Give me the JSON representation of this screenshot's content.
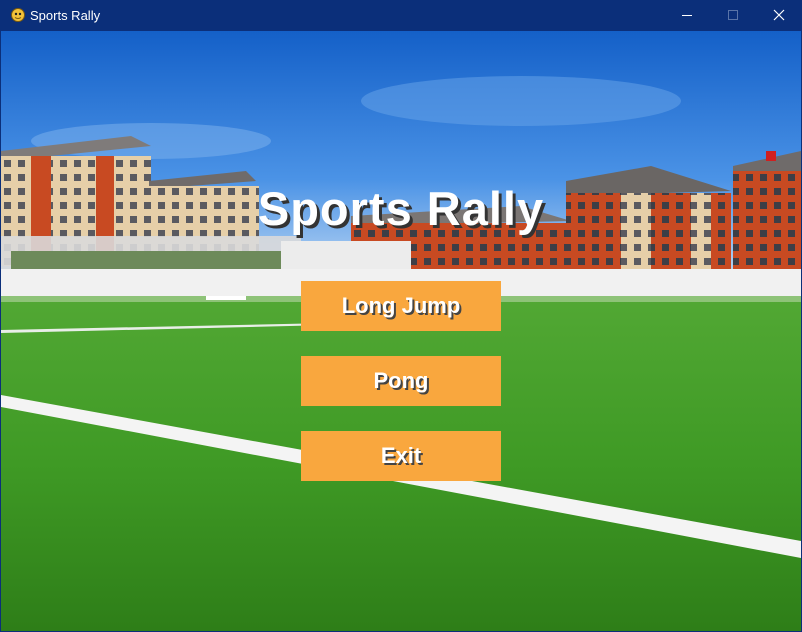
{
  "window": {
    "title": "Sports Rally",
    "controls": [
      "minimize-icon",
      "maximize-icon",
      "close-icon"
    ]
  },
  "game": {
    "title": "Sports Rally",
    "menu": [
      {
        "label": "Long Jump"
      },
      {
        "label": "Pong"
      },
      {
        "label": "Exit"
      }
    ]
  },
  "colors": {
    "titlebar": "#0b2f7a",
    "button": "#f9a73e",
    "text": "#ffffff",
    "sky": "#1e6fd4",
    "grass": "#3f9a25"
  }
}
